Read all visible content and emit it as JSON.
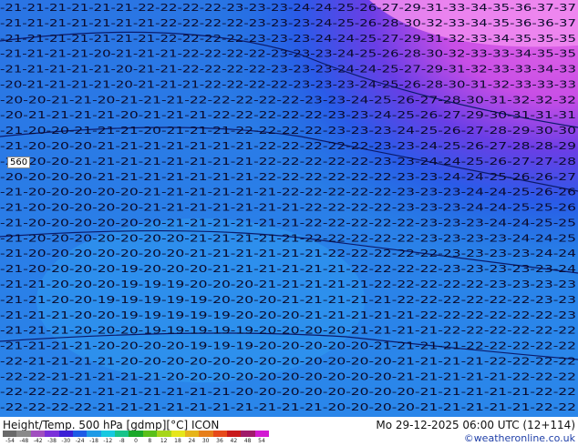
{
  "map": {
    "contour_label": "560",
    "value_rows": [
      "-21-21-21-21-21-21-22-22-22-22-23-23-23-24-24-25-26-27-29-31-33-34-35-36-37-37",
      "-21-21-21-21-21-21-21-22-22-22-22-23-23-23-24-25-26-28-30-32-33-34-35-36-36-37",
      "-21-21-21-21-21-21-21-22-22-22-22-23-23-23-24-24-25-27-29-31-32-33-34-35-35-35",
      "-21-21-21-21-20-21-21-21-22-22-22-22-23-23-23-24-25-26-28-30-32-33-33-34-35-35",
      "-21-21-21-21-21-20-21-21-22-22-22-22-23-23-23-24-24-25-27-29-31-32-33-33-34-33",
      "-20-21-21-21-21-20-21-21-21-22-22-22-22-23-23-23-24-25-26-28-30-31-32-33-33-33",
      "-20-20-21-21-20-21-21-21-22-22-22-22-22-23-23-24-25-26-27-28-30-31-32-32-32",
      "-20-21-21-21-21-20-21-21-21-22-22-22-22-22-23-23-24-25-26-27-29-30-31-31-31",
      "-21-20-20-21-21-21-20-21-21-21-22-22-22-22-23-23-23-24-25-26-27-28-29-30-30",
      "-21-20-20-20-21-21-21-21-21-21-21-22-22-22-22-22-23-23-24-25-26-27-28-28-29",
      "-20-20-20-21-21-21-21-21-21-21-21-22-22-22-22-22-23-23-24-24-25-26-27-27-28",
      "-20-20-20-20-21-21-21-21-21-21-21-22-22-22-22-22-22-23-23-24-24-25-26-26-27",
      "-21-20-20-20-20-20-21-21-21-21-21-21-22-22-22-22-22-23-23-23-24-24-25-26-26",
      "-21-20-20-20-20-20-21-21-21-21-21-21-21-22-22-22-22-23-23-23-24-24-25-25-26",
      "-21-20-20-20-20-20-20-21-21-21-21-21-21-22-22-22-22-22-23-23-23-24-24-25-25",
      "-21-20-20-20-20-20-20-20-21-21-21-21-21-22-22-22-22-22-23-23-23-23-24-24-25",
      "-21-20-20-20-20-20-20-20-21-21-21-21-21-21-22-22-22-22-22-23-23-23-23-24-24",
      "-21-20-20-20-20-19-20-20-20-21-21-21-21-21-21-22-22-22-22-23-23-23-23-23-24",
      "-21-21-20-20-20-19-19-19-20-20-20-21-21-21-21-21-22-22-22-22-22-23-23-23-23",
      "-21-21-20-20-19-19-19-19-19-20-20-20-21-21-21-21-21-22-22-22-22-22-22-23-23",
      "-21-21-21-20-20-19-19-19-19-19-20-20-20-21-21-21-21-21-22-22-22-22-22-22-23",
      "-21-21-21-20-20-20-19-19-19-19-19-20-20-20-20-21-21-21-21-22-22-22-22-22-22",
      "-21-21-21-21-20-20-20-20-19-19-19-20-20-20-20-20-21-21-21-21-22-22-22-22-22",
      "-22-21-21-21-21-20-20-20-20-20-20-20-20-20-20-20-20-21-21-21-21-22-22-22-22",
      "-22-22-21-21-21-21-21-20-20-20-20-20-20-20-20-20-20-21-21-21-21-21-22-22-22",
      "-22-22-22-21-21-21-21-21-21-21-20-20-20-20-20-20-20-20-21-21-21-21-21-22-22",
      "-22-22-22-22-21-21-21-21-21-21-21-21-21-21-20-20-20-20-21-21-21-21-21-22-22"
    ]
  },
  "footer": {
    "title": "Height/Temp. 500 hPa [gdmp][°C] ICON",
    "time": "Mo 29-12-2025 06:00 UTC (12+114)",
    "credit": "©weatheronline.co.uk"
  },
  "legend": {
    "ticks": [
      "-54",
      "-48",
      "-42",
      "-38",
      "-30",
      "-24",
      "-18",
      "-12",
      "-8",
      "0",
      "8",
      "12",
      "18",
      "24",
      "30",
      "36",
      "42",
      "48",
      "54"
    ],
    "colors": [
      "#6a6a6a",
      "#8a8a8a",
      "#a14fbf",
      "#7a2fd9",
      "#3c1fd6",
      "#1e5ce6",
      "#1e9ae6",
      "#17c9e0",
      "#18c48a",
      "#1aa82a",
      "#5ac01a",
      "#a6d61a",
      "#e6e61a",
      "#e6b41a",
      "#e67e1a",
      "#e64a1a",
      "#c81a1a",
      "#a01a6a",
      "#d21ad2"
    ]
  }
}
